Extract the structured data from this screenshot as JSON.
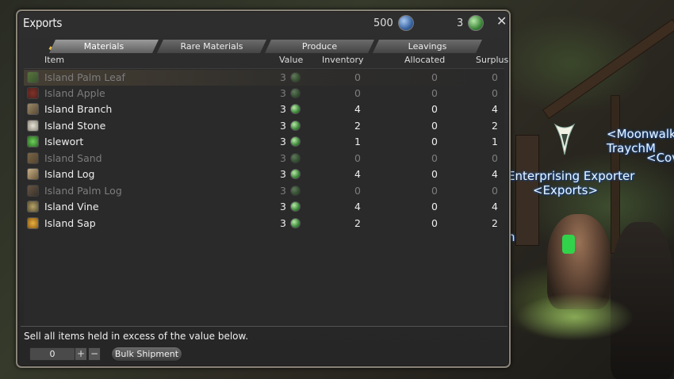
{
  "background": {
    "npc_name": "Enterprising Exporter",
    "npc_title": "<Exports>",
    "player_line1": "<Moonwalk",
    "player_line2": "TraychM",
    "player_line3": "<Cov",
    "fragment_n": "n"
  },
  "window": {
    "title": "Exports",
    "currency1": {
      "amount": "500",
      "icon": "seafarer-cowrie-icon",
      "color": "#3a66a5"
    },
    "currency2": {
      "amount": "3",
      "icon": "islander-cowrie-icon",
      "color": "#3f8a3c"
    },
    "close_icon": "close-icon"
  },
  "tabs": [
    "Materials",
    "Rare Materials",
    "Produce",
    "Leavings"
  ],
  "active_tab": "Materials",
  "columns": {
    "item": "Item",
    "value": "Value",
    "inventory": "Inventory",
    "allocated": "Allocated",
    "surplus": "Surplus"
  },
  "rows": [
    {
      "name": "Island Palm Leaf",
      "value": "3",
      "inventory": "0",
      "allocated": "0",
      "surplus": "0",
      "icon": "ic-palmleaf",
      "dim": true,
      "highlight": true
    },
    {
      "name": "Island Apple",
      "value": "3",
      "inventory": "0",
      "allocated": "0",
      "surplus": "0",
      "icon": "ic-apple",
      "dim": true
    },
    {
      "name": "Island Branch",
      "value": "3",
      "inventory": "4",
      "allocated": "0",
      "surplus": "4",
      "icon": "ic-branch",
      "dim": false
    },
    {
      "name": "Island Stone",
      "value": "3",
      "inventory": "2",
      "allocated": "0",
      "surplus": "2",
      "icon": "ic-stone",
      "dim": false
    },
    {
      "name": "Islewort",
      "value": "3",
      "inventory": "1",
      "allocated": "0",
      "surplus": "1",
      "icon": "ic-islewort",
      "dim": false
    },
    {
      "name": "Island Sand",
      "value": "3",
      "inventory": "0",
      "allocated": "0",
      "surplus": "0",
      "icon": "ic-sand",
      "dim": true
    },
    {
      "name": "Island Log",
      "value": "3",
      "inventory": "4",
      "allocated": "0",
      "surplus": "4",
      "icon": "ic-log",
      "dim": false
    },
    {
      "name": "Island Palm Log",
      "value": "3",
      "inventory": "0",
      "allocated": "0",
      "surplus": "0",
      "icon": "ic-palmlog",
      "dim": true
    },
    {
      "name": "Island Vine",
      "value": "3",
      "inventory": "4",
      "allocated": "0",
      "surplus": "4",
      "icon": "ic-vine",
      "dim": false
    },
    {
      "name": "Island Sap",
      "value": "3",
      "inventory": "2",
      "allocated": "0",
      "surplus": "2",
      "icon": "ic-sap",
      "dim": false
    }
  ],
  "footer": {
    "text": "Sell all items held in excess of the value below.",
    "quantity": "0",
    "plus": "+",
    "minus": "−",
    "bulk_button": "Bulk Shipment"
  }
}
